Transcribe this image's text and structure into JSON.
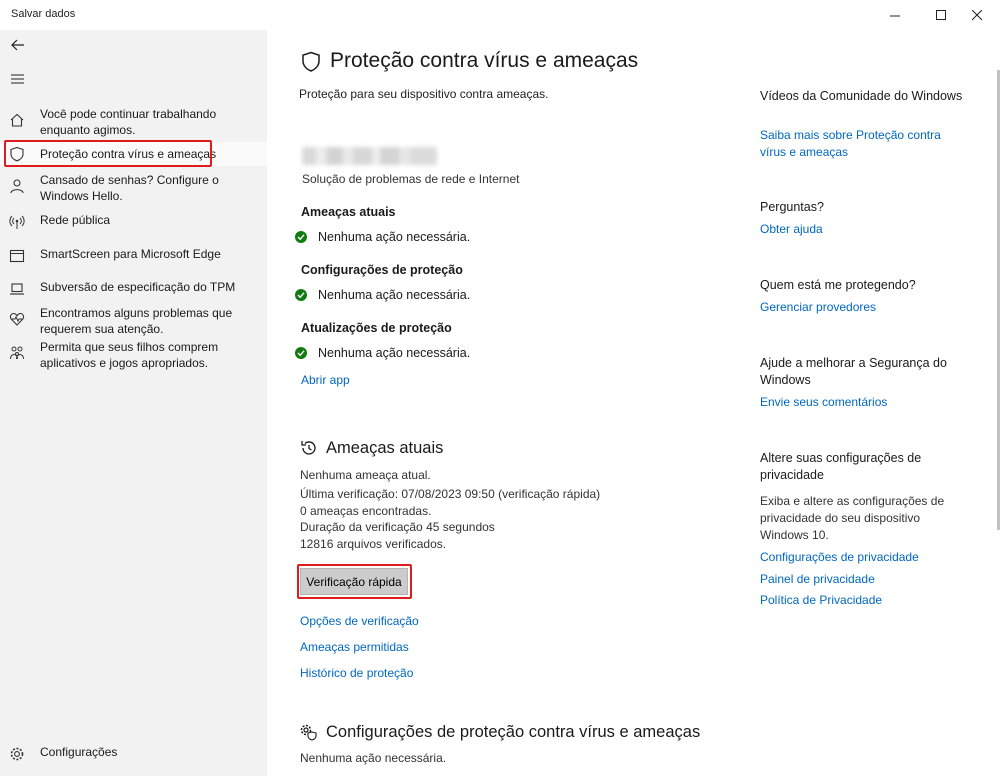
{
  "window": {
    "title": "Salvar dados"
  },
  "sidebar": {
    "items": [
      {
        "label": "Você pode continuar trabalhando enquanto agimos.",
        "icon": "home-icon"
      },
      {
        "label": "Proteção contra vírus e ameaças",
        "icon": "shield-icon"
      },
      {
        "label": "Cansado de senhas? Configure o Windows Hello.",
        "icon": "person-icon"
      },
      {
        "label": "Rede pública",
        "icon": "antenna-icon"
      },
      {
        "label": "SmartScreen para Microsoft Edge",
        "icon": "app-browser-icon"
      },
      {
        "label": "Subversão de especificação do TPM",
        "icon": "laptop-icon"
      },
      {
        "label": "Encontramos alguns problemas que requerem sua atenção.",
        "icon": "heart-pulse-icon"
      },
      {
        "label": "Permita que seus filhos comprem aplicativos e jogos apropriados.",
        "icon": "family-icon"
      }
    ],
    "settings_label": "Configurações"
  },
  "main": {
    "title": "Proteção contra vírus e ameaças",
    "subtitle": "Proteção para seu dispositivo contra ameaças.",
    "provider_desc": "Solução de problemas de rede e Internet",
    "status_sections": [
      {
        "heading": "Ameaças atuais",
        "status": "Nenhuma ação necessária."
      },
      {
        "heading": "Configurações de proteção",
        "status": "Nenhuma ação necessária."
      },
      {
        "heading": "Atualizações de proteção",
        "status": "Nenhuma ação necessária."
      }
    ],
    "open_app": "Abrir app",
    "threats": {
      "title": "Ameaças atuais",
      "lines": [
        "Nenhuma ameaça atual.",
        "Última verificação: 07/08/2023 09:50 (verificação rápida)",
        "0 ameaças encontradas.",
        "Duração da verificação 45 segundos",
        "12816 arquivos verificados."
      ],
      "quick_scan": "Verificação rápida",
      "links": [
        "Opções de verificação",
        "Ameaças permitidas",
        "Histórico de proteção"
      ]
    },
    "settings_section": {
      "title": "Configurações de proteção contra vírus e ameaças",
      "status": "Nenhuma ação necessária."
    }
  },
  "right": {
    "community": {
      "heading": "Vídeos da Comunidade do Windows",
      "link": "Saiba mais sobre Proteção contra vírus e ameaças"
    },
    "questions": {
      "heading": "Perguntas?",
      "link": "Obter ajuda"
    },
    "who": {
      "heading": "Quem está me protegendo?",
      "link": "Gerenciar provedores"
    },
    "improve": {
      "heading": "Ajude a melhorar a Segurança do Windows",
      "link": "Envie seus comentários"
    },
    "privacy": {
      "heading": "Altere suas configurações de privacidade",
      "text": "Exiba e altere as configurações de privacidade do seu dispositivo Windows 10.",
      "links": [
        "Configurações de privacidade",
        "Painel de privacidade",
        "Política de Privacidade"
      ]
    }
  },
  "colors": {
    "accent": "#0067c0",
    "ok_green": "#107c10",
    "highlight_red": "#e01b1b",
    "sidebar_bg": "#f2f2f2"
  }
}
